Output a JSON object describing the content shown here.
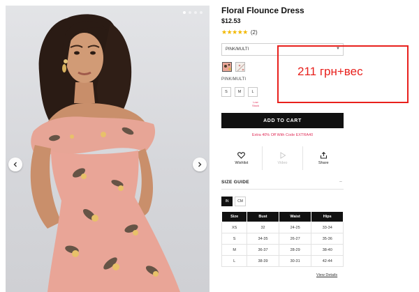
{
  "product": {
    "title": "Floral Flounce Dress",
    "price": "$12.53",
    "rating_stars": "★★★★★",
    "review_count": "(2)",
    "selected_color": "PINK/MULTI",
    "color_dropdown_value": "PINK/MULTI",
    "colors": [
      {
        "name": "PINK/MULTI",
        "swatch_color": "#e9a597",
        "selected": true
      },
      {
        "name": "white-floral",
        "swatch_color": "#f3efea",
        "selected": false
      }
    ],
    "sizes": [
      "S",
      "M",
      "L"
    ],
    "low_stock_label": "Low Stock",
    "add_to_cart_label": "ADD TO CART",
    "promo_text": "Extra 40% Off With Code EXTRA40"
  },
  "gallery": {
    "slide_count": 4,
    "active_slide": 1,
    "prev_icon": "chevron-left-icon",
    "next_icon": "chevron-right-icon"
  },
  "actions": {
    "wishlist_label": "Wishlist",
    "video_label": "Video",
    "share_label": "Share"
  },
  "size_guide": {
    "heading": "SIZE GUIDE",
    "toggle": "–",
    "units": [
      "IN",
      "CM"
    ],
    "active_unit": "IN",
    "columns": [
      "Size",
      "Bust",
      "Waist",
      "Hips"
    ],
    "rows": [
      [
        "XS",
        "32",
        "24-25",
        "33-34"
      ],
      [
        "S",
        "34-35",
        "26-27",
        "35-36"
      ],
      [
        "M",
        "36-37",
        "28-29",
        "38-40"
      ],
      [
        "L",
        "38-39",
        "30-31",
        "42-44"
      ]
    ],
    "view_details_label": "View Details"
  },
  "annotation": {
    "text": "211 грн+вес",
    "color": "#e8201c"
  },
  "colors": {
    "accent_pink": "#e0305a",
    "star_gold": "#f2b800",
    "button_black": "#111111"
  }
}
